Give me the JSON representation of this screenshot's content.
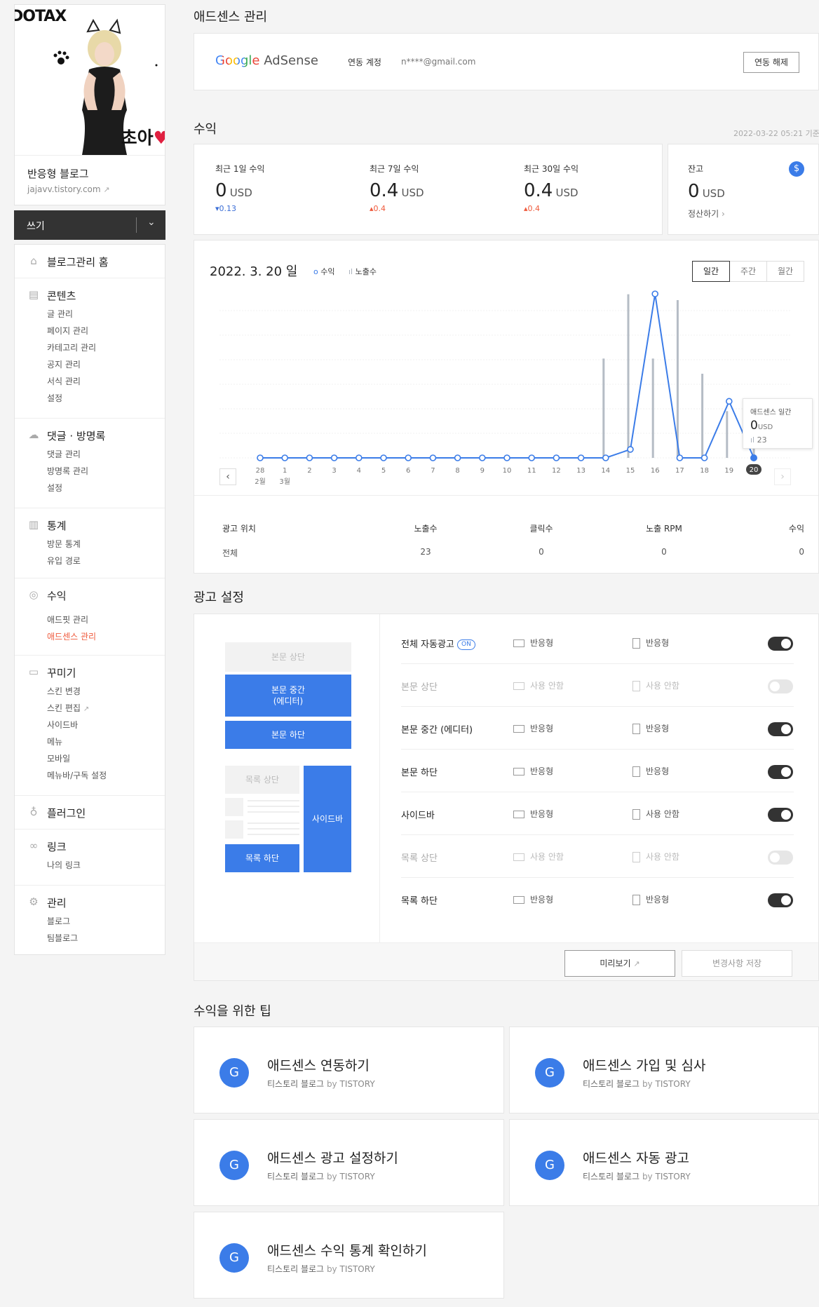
{
  "sidebar": {
    "banner_logo": "DOTAX",
    "banner_text": "초아",
    "blog_name": "반응형 블로그",
    "blog_url": "jajavv.tistory.com",
    "write_label": "쓰기",
    "sections": [
      {
        "title": "블로그관리 홈",
        "icon": "home-icon",
        "items": []
      },
      {
        "title": "콘텐츠",
        "icon": "document-icon",
        "items": [
          "글 관리",
          "페이지 관리",
          "카테고리 관리",
          "공지 관리",
          "서식 관리",
          "설정"
        ]
      },
      {
        "title": "댓글 · 방명록",
        "icon": "comment-icon",
        "items": [
          "댓글 관리",
          "방명록 관리",
          "설정"
        ]
      },
      {
        "title": "통계",
        "icon": "stats-icon",
        "items": [
          "방문 통계",
          "유입 경로"
        ]
      },
      {
        "title": "수익",
        "icon": "coin-icon",
        "items": [
          "애드핏 관리",
          "애드센스 관리"
        ]
      },
      {
        "title": "꾸미기",
        "icon": "layout-icon",
        "items": [
          "스킨 변경",
          "스킨 편집",
          "사이드바",
          "메뉴",
          "모바일",
          "메뉴바/구독 설정"
        ]
      },
      {
        "title": "플러그인",
        "icon": "plugin-icon",
        "items": []
      },
      {
        "title": "링크",
        "icon": "link-icon",
        "items": [
          "나의 링크"
        ]
      },
      {
        "title": "관리",
        "icon": "gear-icon",
        "items": [
          "블로그",
          "팀블로그"
        ]
      }
    ]
  },
  "adsense": {
    "title": "애드센스 관리",
    "logo_google": "Google",
    "logo_adsense": " AdSense",
    "account_label": "연동 계정",
    "account_email": "n****@gmail.com",
    "unlink_label": "연동 해제"
  },
  "revenue": {
    "title": "수익",
    "timestamp": "2022-03-22 05:21 기준",
    "stats": [
      {
        "label": "최근 1일 수익",
        "value": "0",
        "unit": "USD",
        "delta": "0.13",
        "dir": "down"
      },
      {
        "label": "최근 7일 수익",
        "value": "0.4",
        "unit": "USD",
        "delta": "0.4",
        "dir": "up"
      },
      {
        "label": "최근 30일 수익",
        "value": "0.4",
        "unit": "USD",
        "delta": "0.4",
        "dir": "up"
      }
    ],
    "balance": {
      "label": "잔고",
      "value": "0",
      "unit": "USD",
      "settle_label": "정산하기"
    }
  },
  "chart": {
    "date_title": "2022. 3. 20 일",
    "legend_revenue": "수익",
    "legend_impressions": "노출수",
    "tabs": [
      "일간",
      "주간",
      "월간"
    ],
    "active_tab": 0,
    "month_labels": [
      "2월",
      "3월"
    ],
    "tooltip": {
      "title": "애드센스 일간",
      "value": "0",
      "unit": "USD",
      "impressions": "23"
    }
  },
  "chart_data": {
    "type": "line",
    "x": [
      "28",
      "1",
      "2",
      "3",
      "4",
      "5",
      "6",
      "7",
      "8",
      "9",
      "10",
      "11",
      "12",
      "13",
      "14",
      "15",
      "16",
      "17",
      "18",
      "19",
      "20"
    ],
    "series": [
      {
        "name": "수익",
        "values": [
          0,
          0,
          0,
          0,
          0,
          0,
          0,
          0,
          0,
          0,
          0,
          0,
          0,
          0,
          0,
          0.015,
          0.29,
          0,
          0,
          0.1,
          0
        ]
      },
      {
        "name": "노출수",
        "values": [
          0,
          0,
          0,
          0,
          0,
          0,
          0,
          0,
          0,
          0,
          0,
          0,
          0,
          0,
          85,
          140,
          85,
          135,
          72,
          40,
          23
        ]
      }
    ],
    "selected_index": 20
  },
  "table": {
    "headers": [
      "광고 위치",
      "노출수",
      "클릭수",
      "노출 RPM",
      "수익"
    ],
    "rows": [
      [
        "전체",
        "23",
        "0",
        "0",
        "0"
      ]
    ]
  },
  "ad_settings": {
    "title": "광고 설정",
    "preview_boxes": {
      "body_top": "본문 상단",
      "body_mid": "본문 중간\n(에디터)",
      "body_bottom": "본문 하단",
      "list_top": "목록 상단",
      "list_bottom": "목록 하단",
      "sidebar": "사이드바"
    },
    "rows": [
      {
        "label": "전체 자동광고",
        "badge": "ON",
        "pc": "반응형",
        "mobile": "반응형",
        "enabled": true
      },
      {
        "label": "본문 상단",
        "pc": "사용 안함",
        "mobile": "사용 안함",
        "enabled": false
      },
      {
        "label": "본문 중간 (에디터)",
        "pc": "반응형",
        "mobile": "반응형",
        "enabled": true
      },
      {
        "label": "본문 하단",
        "pc": "반응형",
        "mobile": "반응형",
        "enabled": true
      },
      {
        "label": "사이드바",
        "pc": "반응형",
        "mobile": "사용 안함",
        "enabled": true
      },
      {
        "label": "목록 상단",
        "pc": "사용 안함",
        "mobile": "사용 안함",
        "enabled": false
      },
      {
        "label": "목록 하단",
        "pc": "반응형",
        "mobile": "반응형",
        "enabled": true
      }
    ],
    "preview_label": "미리보기",
    "save_label": "변경사항 저장"
  },
  "tips": {
    "title": "수익을 위한 팁",
    "g_letter": "G",
    "source": "티스토리 블로그",
    "by_label": "by",
    "brand": "TISTORY",
    "items": [
      "애드센스 연동하기",
      "애드센스 가입 및 심사",
      "애드센스 광고 설정하기",
      "애드센스 자동 광고",
      "애드센스 수익 통계 확인하기"
    ]
  },
  "colors": {
    "accent_blue": "#3b7ce8",
    "active_red": "#ef5a3c",
    "dark": "#333333"
  }
}
